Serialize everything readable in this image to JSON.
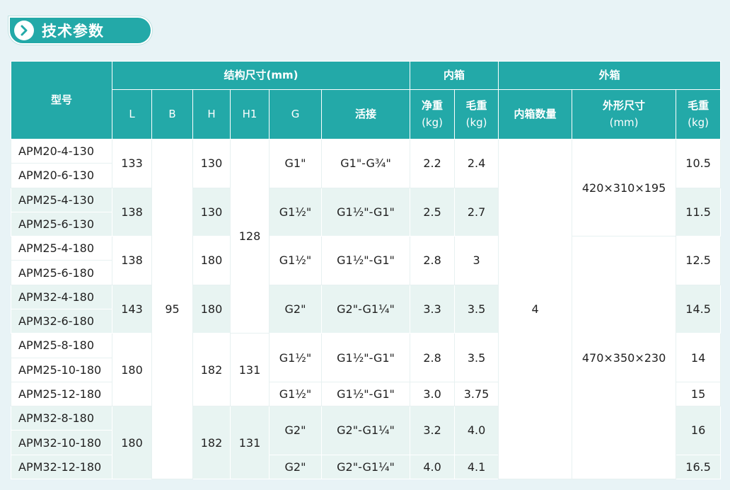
{
  "title": "技术参数",
  "icon": "chevron-right-icon",
  "colors": {
    "header": "#23a9a8",
    "alt_row": "#e8f4f2",
    "background": "#e8f3f6"
  },
  "headers": {
    "model": "型号",
    "structure": "结构尺寸(mm)",
    "inner_box": "内箱",
    "outer_box": "外箱",
    "L": "L",
    "B": "B",
    "H": "H",
    "H1": "H1",
    "G": "G",
    "fitting": "活接",
    "net_weight": "净重",
    "gross_weight": "毛重",
    "kg": "(kg)",
    "inner_qty": "内箱数量",
    "outer_size": "外形尺寸",
    "mm": "(mm)"
  },
  "models": [
    "APM20-4-130",
    "APM20-6-130",
    "APM25-4-130",
    "APM25-6-130",
    "APM25-4-180",
    "APM25-6-180",
    "APM32-4-180",
    "APM32-6-180",
    "APM25-8-180",
    "APM25-10-180",
    "APM25-12-180",
    "APM32-8-180",
    "APM32-10-180",
    "APM32-12-180"
  ],
  "groups": [
    {
      "L": "133",
      "H": "130",
      "G": "G1\"",
      "fitting": "G1\"-G¾\"",
      "net": "2.2",
      "gross": "2.4",
      "outer_gross": "10.5"
    },
    {
      "L": "138",
      "H": "130",
      "G": "G1½\"",
      "fitting": "G1½\"-G1\"",
      "net": "2.5",
      "gross": "2.7",
      "outer_gross": "11.5"
    },
    {
      "L": "138",
      "H": "180",
      "G": "G1½\"",
      "fitting": "G1½\"-G1\"",
      "net": "2.8",
      "gross": "3",
      "outer_gross": "12.5"
    },
    {
      "L": "143",
      "H": "180",
      "G": "G2\"",
      "fitting": "G2\"-G1¼\"",
      "net": "3.3",
      "gross": "3.5",
      "outer_gross": "14.5"
    },
    {
      "L": "180",
      "H": "182",
      "H1": "131",
      "rows": [
        {
          "G": "G1½\"",
          "fitting": "G1½\"-G1\"",
          "net": "2.8",
          "gross": "3.5",
          "outer_gross": "14"
        },
        {
          "G": "G1½\"",
          "fitting": "G1½\"-G1\"",
          "net": "3.0",
          "gross": "3.75",
          "outer_gross": "15"
        }
      ]
    },
    {
      "L": "180",
      "H": "182",
      "H1": "131",
      "rows": [
        {
          "G": "G2\"",
          "fitting": "G2\"-G1¼\"",
          "net": "3.2",
          "gross": "4.0",
          "outer_gross": "16"
        },
        {
          "G": "G2\"",
          "fitting": "G2\"-G1¼\"",
          "net": "4.0",
          "gross": "4.1",
          "outer_gross": "16.5"
        }
      ]
    }
  ],
  "shared": {
    "B": "95",
    "H1_first": "128",
    "inner_qty": "4",
    "outer_size_1": "420×310×195",
    "outer_size_2": "470×350×230"
  }
}
